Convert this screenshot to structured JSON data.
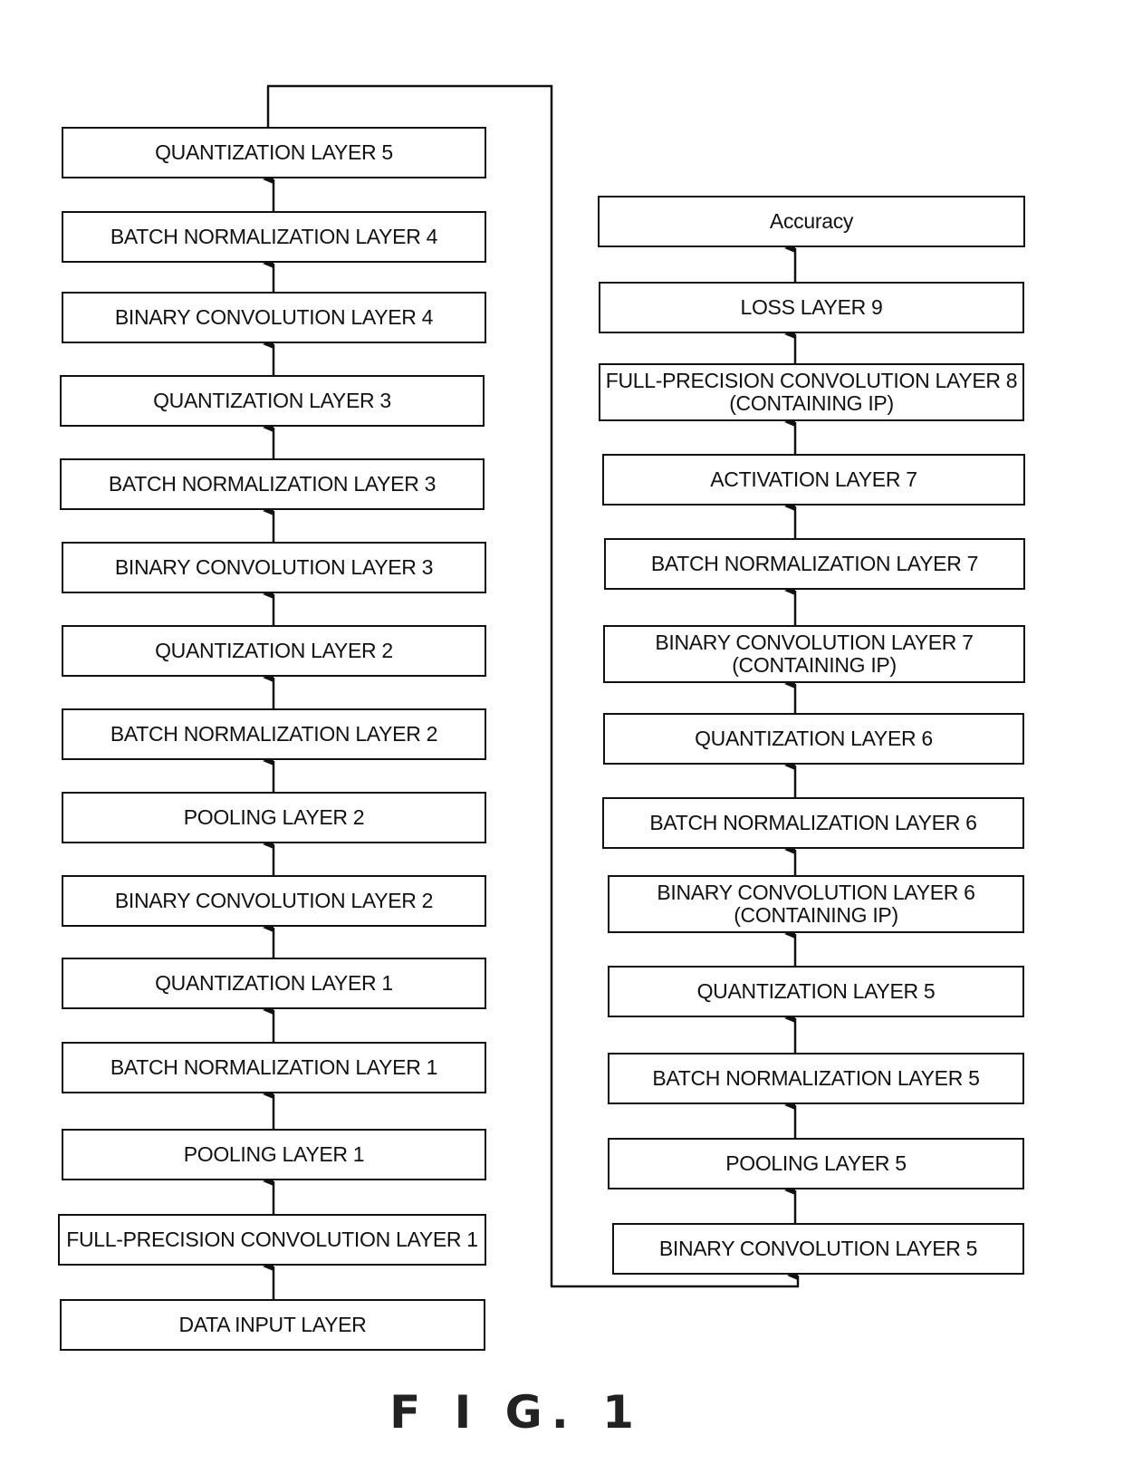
{
  "figure_label": "F I G.  1",
  "left_column": [
    {
      "id": "L1",
      "label": "QUANTIZATION LAYER 5"
    },
    {
      "id": "L2",
      "label": "BATCH NORMALIZATION LAYER 4"
    },
    {
      "id": "L3",
      "label": "BINARY CONVOLUTION LAYER 4"
    },
    {
      "id": "L4",
      "label": "QUANTIZATION LAYER 3"
    },
    {
      "id": "L5",
      "label": "BATCH NORMALIZATION LAYER 3"
    },
    {
      "id": "L6",
      "label": "BINARY CONVOLUTION LAYER 3"
    },
    {
      "id": "L7",
      "label": "QUANTIZATION LAYER 2"
    },
    {
      "id": "L8",
      "label": "BATCH NORMALIZATION LAYER 2"
    },
    {
      "id": "L9",
      "label": "POOLING LAYER 2"
    },
    {
      "id": "L10",
      "label": "BINARY CONVOLUTION LAYER 2"
    },
    {
      "id": "L11",
      "label": "QUANTIZATION LAYER 1"
    },
    {
      "id": "L12",
      "label": "BATCH NORMALIZATION LAYER 1"
    },
    {
      "id": "L13",
      "label": "POOLING LAYER 1"
    },
    {
      "id": "L14",
      "label": "FULL-PRECISION CONVOLUTION LAYER 1"
    },
    {
      "id": "L15",
      "label": "DATA INPUT LAYER"
    }
  ],
  "right_column": [
    {
      "id": "R1",
      "label": "Accuracy"
    },
    {
      "id": "R2",
      "label": "LOSS LAYER 9"
    },
    {
      "id": "R3",
      "label": "FULL-PRECISION CONVOLUTION LAYER 8\n(CONTAINING IP)"
    },
    {
      "id": "R4",
      "label": "ACTIVATION LAYER 7"
    },
    {
      "id": "R5",
      "label": "BATCH NORMALIZATION LAYER 7"
    },
    {
      "id": "R6",
      "label": "BINARY CONVOLUTION LAYER 7\n(CONTAINING IP)"
    },
    {
      "id": "R7",
      "label": "QUANTIZATION LAYER 6"
    },
    {
      "id": "R8",
      "label": "BATCH NORMALIZATION LAYER 6"
    },
    {
      "id": "R9",
      "label": "BINARY CONVOLUTION LAYER 6\n(CONTAINING IP)"
    },
    {
      "id": "R10",
      "label": "QUANTIZATION LAYER 5"
    },
    {
      "id": "R11",
      "label": "BATCH NORMALIZATION LAYER 5"
    },
    {
      "id": "R12",
      "label": "POOLING LAYER 5"
    },
    {
      "id": "R13",
      "label": "BINARY CONVOLUTION LAYER 5"
    }
  ],
  "flow": "bottom-to-top; left column output (QUANTIZATION LAYER 5) connects to right column input (BINARY CONVOLUTION LAYER 5)"
}
